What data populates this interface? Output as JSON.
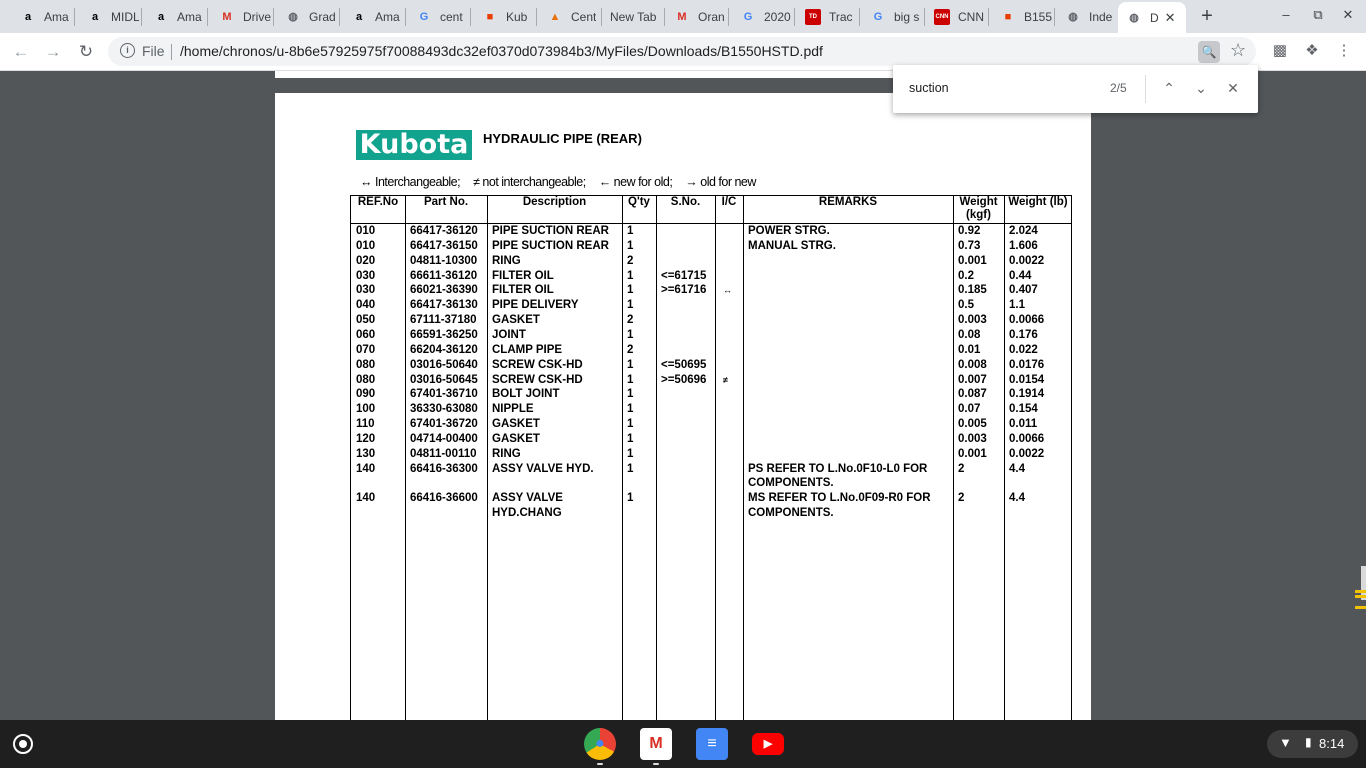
{
  "tabs": [
    {
      "title": "Ama",
      "icon": "amazon-icon",
      "badge": "a",
      "color": "#000"
    },
    {
      "title": "MIDL",
      "icon": "amazon-icon",
      "badge": "a",
      "color": "#000"
    },
    {
      "title": "Ama",
      "icon": "amazon-icon",
      "badge": "a",
      "color": "#000"
    },
    {
      "title": "Drive",
      "icon": "gmail-icon",
      "badge": "M",
      "color": "#d93025"
    },
    {
      "title": "Grad",
      "icon": "globe-icon",
      "badge": "◍",
      "color": "#5f6368"
    },
    {
      "title": "Ama",
      "icon": "amazon-icon",
      "badge": "a",
      "color": "#000"
    },
    {
      "title": "cent",
      "icon": "google-icon",
      "badge": "G",
      "color": "#4285f4"
    },
    {
      "title": "Kub",
      "icon": "office-icon",
      "badge": "■",
      "color": "#eb3c00"
    },
    {
      "title": "Cent",
      "icon": "onion-icon",
      "badge": "▲",
      "color": "#e8710a"
    },
    {
      "title": "New Tab",
      "icon": "",
      "badge": "",
      "color": "#000"
    },
    {
      "title": "Oran",
      "icon": "gmail-icon",
      "badge": "M",
      "color": "#d93025"
    },
    {
      "title": "2020",
      "icon": "google-icon",
      "badge": "G",
      "color": "#4285f4"
    },
    {
      "title": "Trac",
      "icon": "td-icon",
      "badge": "TD",
      "color": "#c00"
    },
    {
      "title": "big s",
      "icon": "google-icon",
      "badge": "G",
      "color": "#4285f4"
    },
    {
      "title": "CNN",
      "icon": "cnn-icon",
      "badge": "CNN",
      "color": "#c00"
    },
    {
      "title": "B155",
      "icon": "office-icon",
      "badge": "■",
      "color": "#eb3c00"
    },
    {
      "title": "Inde",
      "icon": "globe-icon",
      "badge": "◍",
      "color": "#5f6368"
    },
    {
      "title": "D",
      "icon": "globe-icon",
      "badge": "◍",
      "color": "#5f6368",
      "active": true
    }
  ],
  "toolbar": {
    "file_label": "File",
    "url": "/home/chronos/u-8b6e57925975f70088493dc32ef0370d073984b3/MyFiles/Downloads/B1550HSTD.pdf"
  },
  "findbar": {
    "query": "suction",
    "count": "2/5"
  },
  "document": {
    "logo_text": "Kubota",
    "title": "HYDRAULIC PIPE (REAR)",
    "legend": [
      "↔ Interchangeable;",
      "≠ not interchangeable;",
      "← new for old;",
      "→ old for new"
    ],
    "columns": [
      "REF.No",
      "Part No.",
      "Description",
      "Q'ty",
      "S.No.",
      "I/C",
      "REMARKS",
      "Weight (kgf)",
      "Weight (lb)"
    ],
    "rows": [
      {
        "ref": "010",
        "part": "66417-36120",
        "desc": "PIPE SUCTION REAR",
        "qty": "1",
        "sno": "",
        "ic": "",
        "remarks": "POWER STRG.",
        "kgf": "0.92",
        "lb": "2.024"
      },
      {
        "ref": "010",
        "part": "66417-36150",
        "desc": "PIPE SUCTION REAR",
        "qty": "1",
        "sno": "",
        "ic": "",
        "remarks": "MANUAL STRG.",
        "kgf": "0.73",
        "lb": "1.606"
      },
      {
        "ref": "020",
        "part": "04811-10300",
        "desc": "RING",
        "qty": "2",
        "sno": "",
        "ic": "",
        "remarks": "",
        "kgf": "0.001",
        "lb": "0.0022"
      },
      {
        "ref": "030",
        "part": "66611-36120",
        "desc": "FILTER OIL",
        "qty": "1",
        "sno": "<=61715",
        "ic": "",
        "remarks": "",
        "kgf": "0.2",
        "lb": "0.44"
      },
      {
        "ref": "030",
        "part": "66021-36390",
        "desc": "FILTER OIL",
        "qty": "1",
        "sno": ">=61716",
        "ic": "↔",
        "remarks": "",
        "kgf": "0.185",
        "lb": "0.407"
      },
      {
        "ref": "040",
        "part": "66417-36130",
        "desc": "PIPE DELIVERY",
        "qty": "1",
        "sno": "",
        "ic": "",
        "remarks": "",
        "kgf": "0.5",
        "lb": "1.1"
      },
      {
        "ref": "050",
        "part": "67111-37180",
        "desc": "GASKET",
        "qty": "2",
        "sno": "",
        "ic": "",
        "remarks": "",
        "kgf": "0.003",
        "lb": "0.0066"
      },
      {
        "ref": "060",
        "part": "66591-36250",
        "desc": "JOINT",
        "qty": "1",
        "sno": "",
        "ic": "",
        "remarks": "",
        "kgf": "0.08",
        "lb": "0.176"
      },
      {
        "ref": "070",
        "part": "66204-36120",
        "desc": "CLAMP PIPE",
        "qty": "2",
        "sno": "",
        "ic": "",
        "remarks": "",
        "kgf": "0.01",
        "lb": "0.022"
      },
      {
        "ref": "080",
        "part": "03016-50640",
        "desc": "SCREW CSK-HD",
        "qty": "1",
        "sno": "<=50695",
        "ic": "",
        "remarks": "",
        "kgf": "0.008",
        "lb": "0.0176"
      },
      {
        "ref": "080",
        "part": "03016-50645",
        "desc": "SCREW CSK-HD",
        "qty": "1",
        "sno": ">=50696",
        "ic": "≠",
        "remarks": "",
        "kgf": "0.007",
        "lb": "0.0154"
      },
      {
        "ref": "090",
        "part": "67401-36710",
        "desc": "BOLT JOINT",
        "qty": "1",
        "sno": "",
        "ic": "",
        "remarks": "",
        "kgf": "0.087",
        "lb": "0.1914"
      },
      {
        "ref": "100",
        "part": "36330-63080",
        "desc": "NIPPLE",
        "qty": "1",
        "sno": "",
        "ic": "",
        "remarks": "",
        "kgf": "0.07",
        "lb": "0.154"
      },
      {
        "ref": "110",
        "part": "67401-36720",
        "desc": "GASKET",
        "qty": "1",
        "sno": "",
        "ic": "",
        "remarks": "",
        "kgf": "0.005",
        "lb": "0.011"
      },
      {
        "ref": "120",
        "part": "04714-00400",
        "desc": "GASKET",
        "qty": "1",
        "sno": "",
        "ic": "",
        "remarks": "",
        "kgf": "0.003",
        "lb": "0.0066"
      },
      {
        "ref": "130",
        "part": "04811-00110",
        "desc": "RING",
        "qty": "1",
        "sno": "",
        "ic": "",
        "remarks": "",
        "kgf": "0.001",
        "lb": "0.0022"
      },
      {
        "ref": "140",
        "part": "66416-36300",
        "desc": "ASSY VALVE HYD.",
        "qty": "1",
        "sno": "",
        "ic": "",
        "remarks": "PS REFER TO L.No.0F10-L0 FOR COMPONENTS.",
        "kgf": "2",
        "lb": "4.4"
      },
      {
        "ref": "140",
        "part": "66416-36600",
        "desc": "ASSY VALVE HYD.CHANG",
        "qty": "1",
        "sno": "",
        "ic": "",
        "remarks": "MS REFER TO L.No.0F09-R0 FOR COMPONENTS.",
        "kgf": "2",
        "lb": "4.4"
      }
    ]
  },
  "shelf": {
    "apps": [
      {
        "name": "chrome-app",
        "color": "#4285f4"
      },
      {
        "name": "gmail-app",
        "color": "#d93025"
      },
      {
        "name": "docs-app",
        "color": "#4285f4"
      },
      {
        "name": "youtube-app",
        "color": "#ff0000"
      }
    ],
    "time": "8:14"
  }
}
